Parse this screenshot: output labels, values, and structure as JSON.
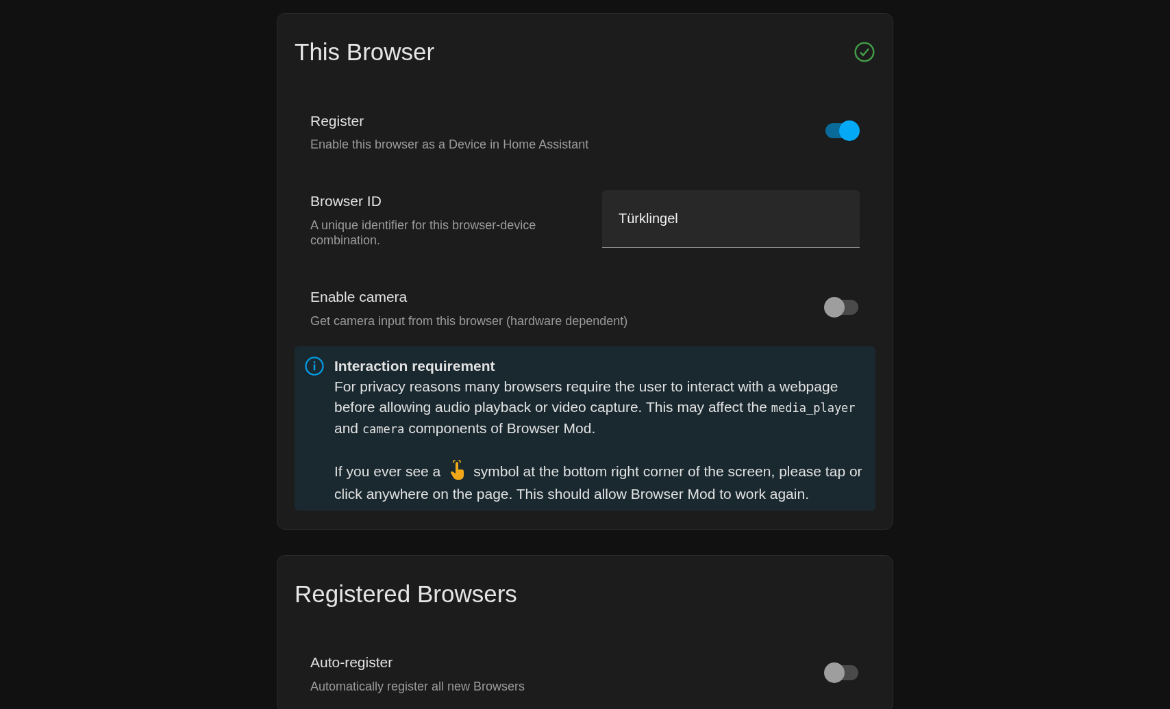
{
  "cards": [
    {
      "title": "This Browser",
      "verified": true,
      "rows": [
        {
          "kind": "switch",
          "label": "Register",
          "description": "Enable this browser as a Device in Home Assistant",
          "on": true
        },
        {
          "kind": "text_field",
          "label": "Browser ID",
          "description": "A unique identifier for this browser-device combination.",
          "value": "Türklingel"
        },
        {
          "kind": "switch",
          "label": "Enable camera",
          "description": "Get camera input from this browser (hardware dependent)",
          "on": false
        }
      ],
      "alert": {
        "title": "Interaction requirement",
        "paragraphs": [
          [
            {
              "kind": "text",
              "text": "For privacy reasons many browsers require the user to interact with a webpage before allowing audio playback or video capture. This may affect the "
            },
            {
              "kind": "code",
              "text": "media_player"
            },
            {
              "kind": "text",
              "text": " and "
            },
            {
              "kind": "code",
              "text": "camera"
            },
            {
              "kind": "text",
              "text": " components of Browser Mod."
            }
          ],
          [
            {
              "kind": "text",
              "text": "If you ever see a"
            },
            {
              "kind": "icon"
            },
            {
              "kind": "text",
              "text": "symbol at the bottom right corner of the screen, please tap or click anywhere on the page. This should allow Browser Mod to work again."
            }
          ]
        ]
      }
    },
    {
      "title": "Registered Browsers",
      "verified": false,
      "rows": [
        {
          "kind": "switch",
          "label": "Auto-register",
          "description": "Automatically register all new Browsers",
          "on": false
        }
      ]
    }
  ]
}
